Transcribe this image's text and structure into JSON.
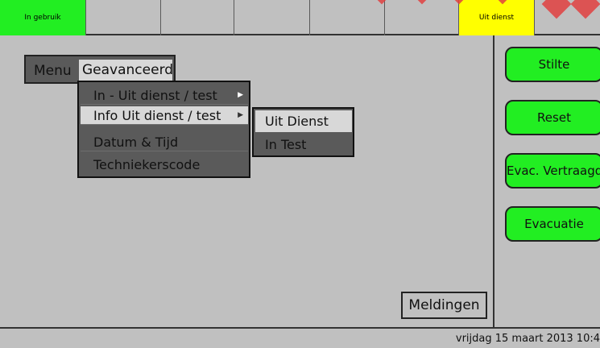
{
  "status_bar_top": {
    "in_use_label": "In gebruik",
    "out_of_service_label": "Uit dienst"
  },
  "colors": {
    "in_use": "#22ee22",
    "out_of_service": "#ffff00",
    "panel_bg": "#c0c0c0",
    "menu_dark": "#5a5a5a",
    "button_green": "#22ee22"
  },
  "menu": {
    "menu_label": "Menu",
    "selected": "Geavanceerd",
    "items": [
      {
        "label": "In - Uit dienst / test",
        "has_submenu": true
      },
      {
        "label": "Info Uit dienst / test",
        "has_submenu": true,
        "highlighted": true
      },
      {
        "label": "Datum & Tijd",
        "has_submenu": false
      },
      {
        "label": "Techniekerscode",
        "has_submenu": false
      }
    ],
    "submenu": [
      {
        "label": "Uit Dienst",
        "highlighted": true
      },
      {
        "label": "In Test"
      }
    ]
  },
  "side_buttons": [
    {
      "label": "Stilte"
    },
    {
      "label": "Reset"
    },
    {
      "label": "Evac. Vertraagd"
    },
    {
      "label": "Evacuatie"
    }
  ],
  "meldingen_label": "Meldingen",
  "datetime": "vrijdag 15 maart 2013 10:4"
}
